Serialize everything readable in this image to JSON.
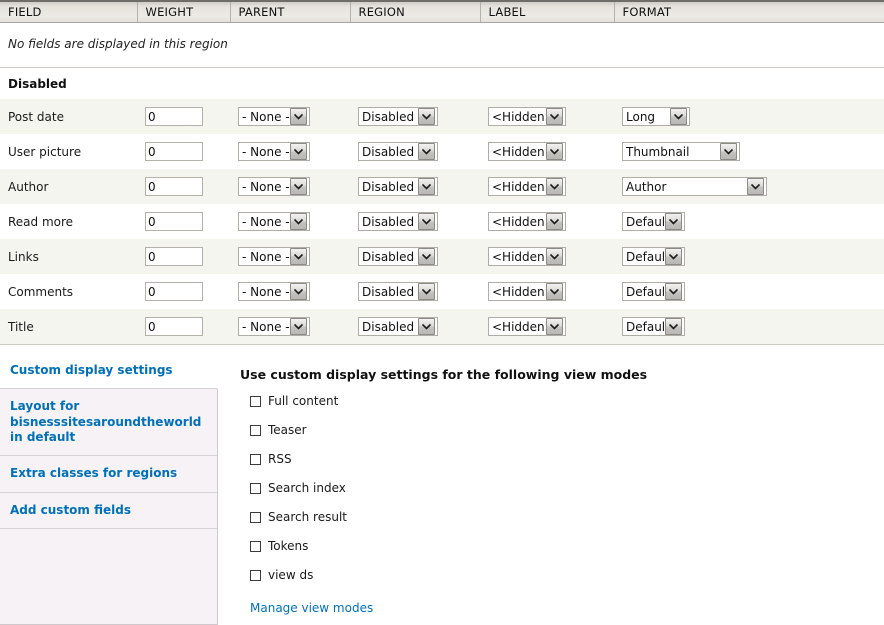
{
  "table": {
    "columns": [
      "FIELD",
      "WEIGHT",
      "PARENT",
      "REGION",
      "LABEL",
      "FORMAT"
    ],
    "empty_region_note": "No fields are displayed in this region",
    "group_label": "Disabled",
    "rows": [
      {
        "field": "Post date",
        "weight": "0",
        "parent": "- None -",
        "region": "Disabled",
        "label": "<Hidden>",
        "format": "Long",
        "format_width": "fmt-long"
      },
      {
        "field": "User picture",
        "weight": "0",
        "parent": "- None -",
        "region": "Disabled",
        "label": "<Hidden>",
        "format": "Thumbnail",
        "format_width": "fmt-thumbnail"
      },
      {
        "field": "Author",
        "weight": "0",
        "parent": "- None -",
        "region": "Disabled",
        "label": "<Hidden>",
        "format": "Author",
        "format_width": "fmt-author"
      },
      {
        "field": "Read more",
        "weight": "0",
        "parent": "- None -",
        "region": "Disabled",
        "label": "<Hidden>",
        "format": "Default",
        "format_width": "fmt-default"
      },
      {
        "field": "Links",
        "weight": "0",
        "parent": "- None -",
        "region": "Disabled",
        "label": "<Hidden>",
        "format": "Default",
        "format_width": "fmt-default"
      },
      {
        "field": "Comments",
        "weight": "0",
        "parent": "- None -",
        "region": "Disabled",
        "label": "<Hidden>",
        "format": "Default",
        "format_width": "fmt-default"
      },
      {
        "field": "Title",
        "weight": "0",
        "parent": "- None -",
        "region": "Disabled",
        "label": "<Hidden>",
        "format": "Default",
        "format_width": "fmt-default"
      }
    ]
  },
  "vertical_tabs": {
    "items": [
      {
        "label": "Custom display settings",
        "selected": true
      },
      {
        "label": "Layout for bisnesssitesaroundtheworld in default",
        "selected": false
      },
      {
        "label": "Extra classes for regions",
        "selected": false
      },
      {
        "label": "Add custom fields",
        "selected": false
      }
    ]
  },
  "custom_display_settings": {
    "title": "Use custom display settings for the following view modes",
    "view_modes": [
      {
        "label": "Full content",
        "checked": false
      },
      {
        "label": "Teaser",
        "checked": false
      },
      {
        "label": "RSS",
        "checked": false
      },
      {
        "label": "Search index",
        "checked": false
      },
      {
        "label": "Search result",
        "checked": false
      },
      {
        "label": "Tokens",
        "checked": false
      },
      {
        "label": "view ds",
        "checked": false
      }
    ],
    "manage_link": "Manage view modes"
  },
  "colors": {
    "link": "#0071b8",
    "row_alt": "#f5f5ef",
    "tabs_bg": "#f7f2f6",
    "header_bg": "#e6e3dd"
  }
}
